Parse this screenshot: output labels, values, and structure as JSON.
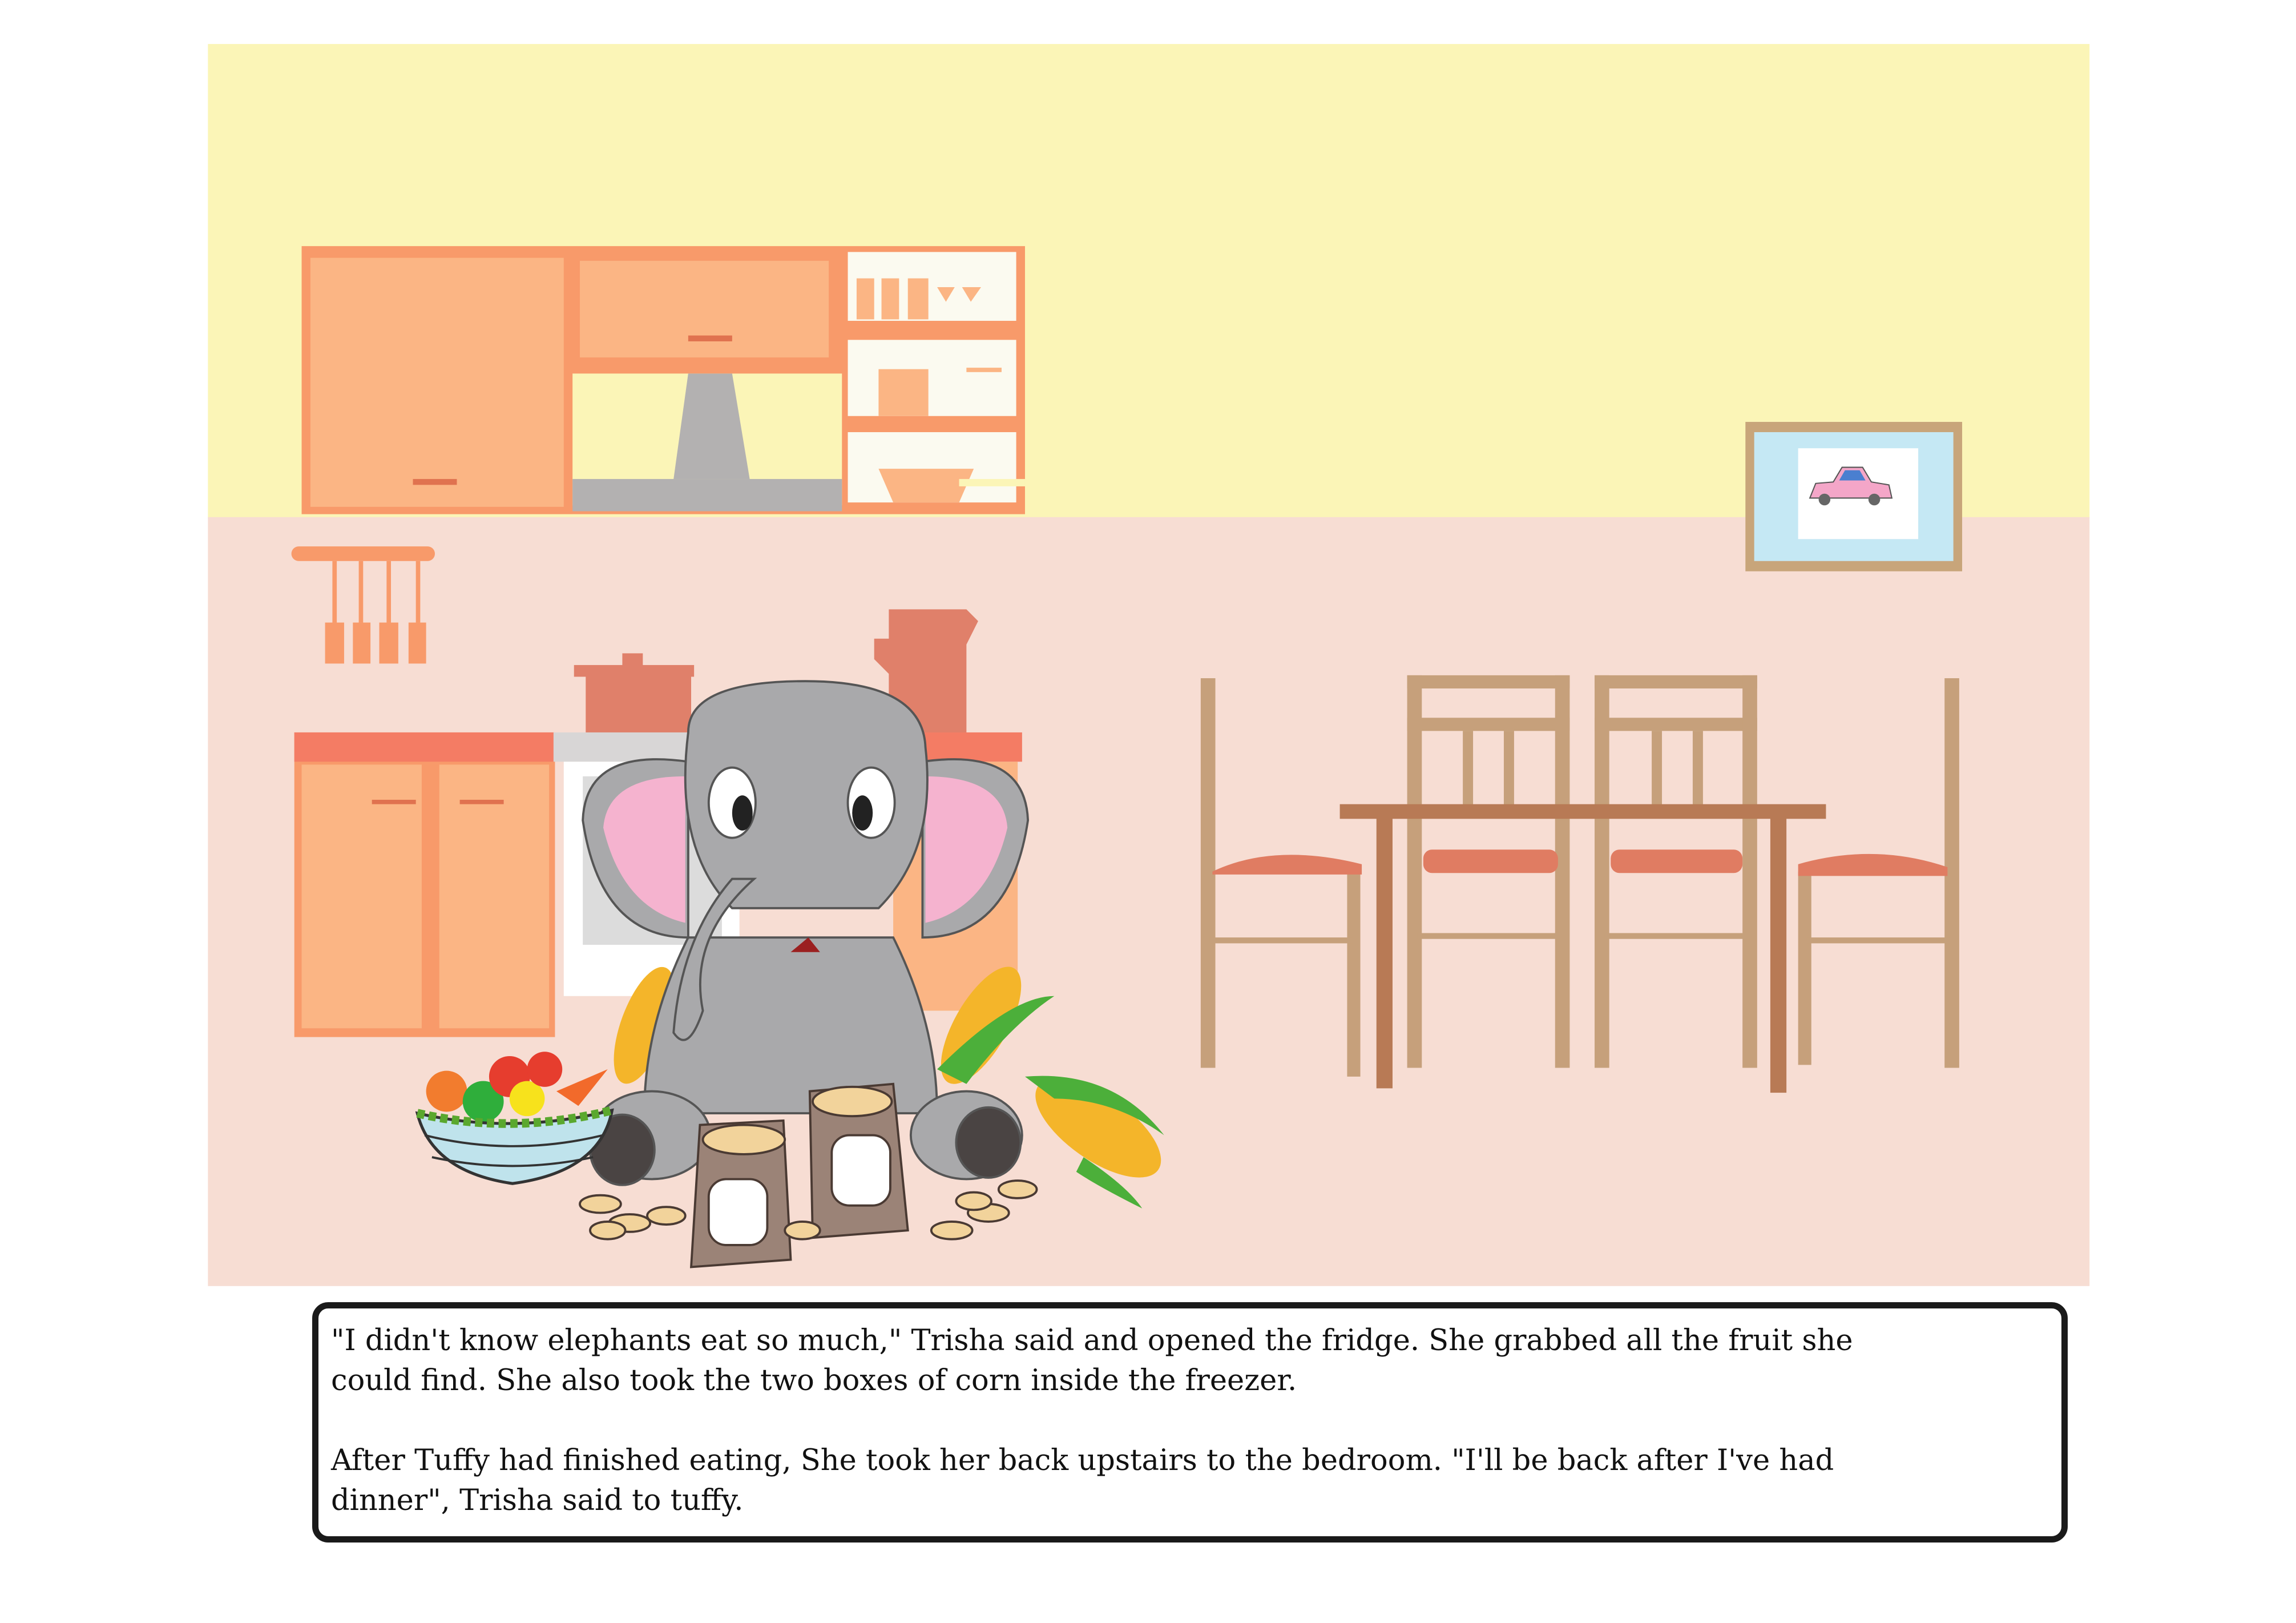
{
  "story": {
    "paragraphs": [
      {
        "lines": [
          "\"I didn't know elephants eat so much,\" Trisha said and opened the fridge. She grabbed all the fruit she",
          "could find. She also took the two boxes of corn inside the freezer."
        ]
      },
      {
        "lines": [
          "After Tuffy had finished eating, She took her back upstairs to the bedroom. \"I'll be back after I've had",
          "dinner\", Trisha said to tuffy."
        ]
      }
    ]
  },
  "colors": {
    "wall_upper": "#fbf5b7",
    "wall_lower": "#f7ddd3",
    "cabinet": "#fbb584",
    "cabinet_border": "#f89a6a",
    "counter_top": "#f47c64",
    "chair": "#c6a07b",
    "table": "#b87a55",
    "elephant": "#a9a9ab",
    "ear_inner": "#f5b3cf"
  }
}
